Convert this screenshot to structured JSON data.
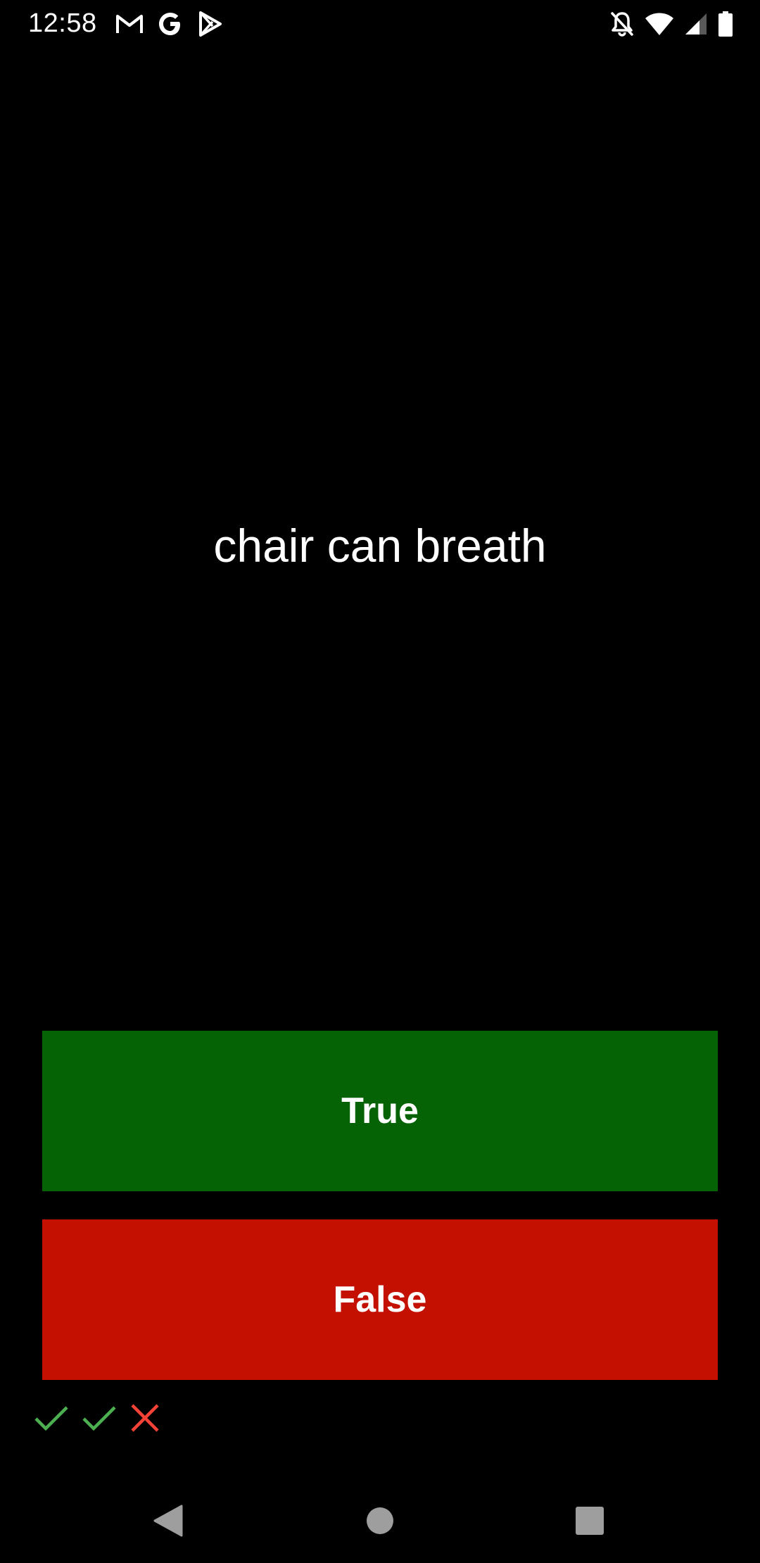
{
  "status_bar": {
    "time": "12:58",
    "left_icons": [
      "gmail-icon",
      "google-icon",
      "play-store-icon"
    ],
    "right_icons": [
      "notifications-off-icon",
      "wifi-icon",
      "cell-signal-icon",
      "battery-icon"
    ]
  },
  "quiz": {
    "statement": "chair can breath",
    "true_label": "True",
    "false_label": "False"
  },
  "history": [
    {
      "result": "correct",
      "icon": "check-icon"
    },
    {
      "result": "correct",
      "icon": "check-icon"
    },
    {
      "result": "wrong",
      "icon": "cross-icon"
    }
  ],
  "colors": {
    "background": "#000000",
    "true_button": "#056306",
    "false_button": "#c41001",
    "check": "#4caf50",
    "cross": "#f44336",
    "nav_icon": "#9e9e9e"
  },
  "nav_bar": {
    "buttons": [
      "back-icon",
      "home-icon",
      "recents-icon"
    ]
  }
}
